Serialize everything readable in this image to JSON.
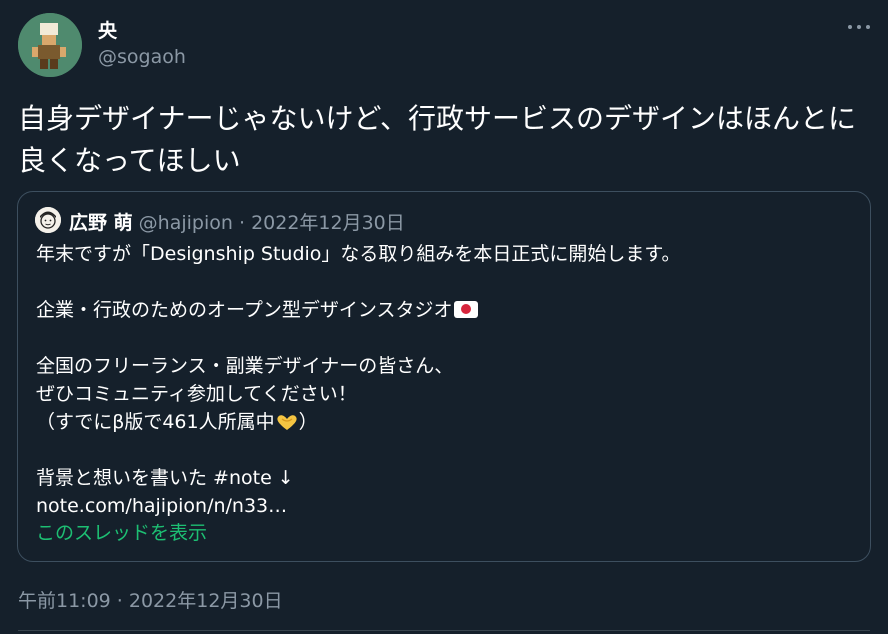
{
  "author": {
    "name": "央",
    "handle": "@sogaoh"
  },
  "tweet": {
    "text": "自身デザイナーじゃないけど、行政サービスのデザインはほんとに良くなってほしい"
  },
  "quoted": {
    "name": "広野 萌",
    "handle": "@hajipion",
    "separator": "·",
    "date": "2022年12月30日",
    "lines": [
      "年末ですが「Designship Studio」なる取り組みを本日正式に開始します。",
      "",
      "企業・行政のためのオープン型デザインスタジオ",
      "",
      "全国のフリーランス・副業デザイナーの皆さん、",
      "ぜひコミュニティ参加してください！",
      "（すでにβ版で461人所属中",
      "",
      "背景と想いを書いた #note ↓",
      "note.com/hajipion/n/n33…"
    ],
    "line3_suffix_icon": "japan-flag-icon",
    "line7_suffix_icon": "heart-hands-icon",
    "line7_tail": "）",
    "show_thread": "このスレッドを表示"
  },
  "timestamp": "午前11:09 · 2022年12月30日",
  "colors": {
    "background": "#15202b",
    "secondary_text": "#8b98a5",
    "link_green": "#1dbf73",
    "card_border": "#3d4f5f"
  }
}
